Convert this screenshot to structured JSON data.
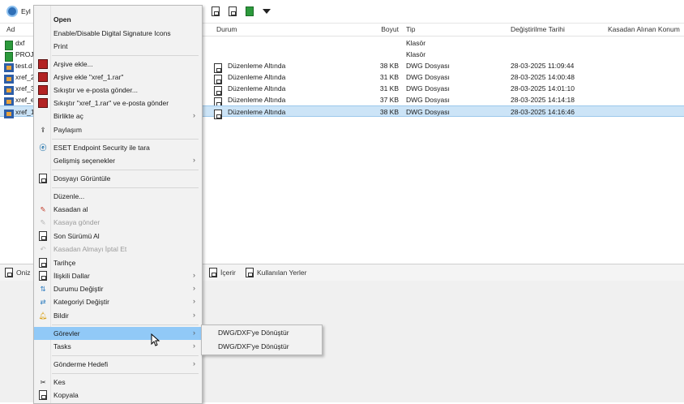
{
  "toolbar": {
    "title": "Eyl"
  },
  "columns": {
    "name": "Ad",
    "status": "Durum",
    "size": "Boyut",
    "type": "Tip",
    "modified": "Değiştirilme Tarihi",
    "checkout": "Kasadan Alınan Konum"
  },
  "rows": [
    {
      "name": "dxf",
      "status": "",
      "size": "",
      "type": "Klasör",
      "modified": "",
      "icon": "folder-icon"
    },
    {
      "name": "PROJE",
      "status": "",
      "size": "",
      "type": "Klasör",
      "modified": "",
      "icon": "folder-icon"
    },
    {
      "name": "test.d",
      "status": "Düzenleme Altında",
      "size": "38 KB",
      "type": "DWG Dosyası",
      "modified": "28-03-2025 11:09:44",
      "icon": "dwg-icon"
    },
    {
      "name": "xref_2",
      "status": "Düzenleme Altında",
      "size": "31 KB",
      "type": "DWG Dosyası",
      "modified": "28-03-2025 14:00:48",
      "icon": "dwg-icon"
    },
    {
      "name": "xref_3",
      "status": "Düzenleme Altında",
      "size": "31 KB",
      "type": "DWG Dosyası",
      "modified": "28-03-2025 14:01:10",
      "icon": "dwg-icon"
    },
    {
      "name": "xref_e",
      "status": "Düzenleme Altında",
      "size": "37 KB",
      "type": "DWG Dosyası",
      "modified": "28-03-2025 14:14:18",
      "icon": "dwg-icon"
    },
    {
      "name": "xref_1",
      "status": "Düzenleme Altında",
      "size": "38 KB",
      "type": "DWG Dosyası",
      "modified": "28-03-2025 14:16:46",
      "icon": "dwg-icon",
      "selected": true
    }
  ],
  "bottom_tabs": [
    "Oniz",
    "İçerir",
    "Kullanılan Yerler"
  ],
  "context_menu": {
    "open": "Open",
    "enable_disable": "Enable/Disable Digital Signature Icons",
    "print": "Print",
    "add_archive": "Arşive ekle...",
    "add_archive_named": "Arşive ekle \"xref_1.rar\"",
    "compress_email": "Sıkıştır ve e-posta gönder...",
    "compress_named_email": "Sıkıştır \"xref_1.rar\" ve e-posta gönder",
    "open_with": "Birlikte aç",
    "share": "Paylaşım",
    "eset_scan": "ESET Endpoint Security ile tara",
    "advanced": "Gelişmiş seçenekler",
    "view_file": "Dosyayı Görüntüle",
    "edit": "Düzenle...",
    "checkout": "Kasadan al",
    "checkin": "Kasaya gönder",
    "latest_version": "Son Sürümü Al",
    "undo_checkout": "Kasadan Almayı İptal Et",
    "history": "Tarihçe",
    "related_branches": "İlişkili Dallar",
    "change_state": "Durumu Değiştir",
    "change_category": "Kategoriyi Değiştir",
    "notify": "Bildir",
    "tasks_tr": "Görevler",
    "tasks": "Tasks",
    "send_to": "Gönderme Hedefi",
    "cut": "Kes",
    "copy": "Kopyala"
  },
  "submenu": {
    "item1": "DWG/DXF'ye Dönüştür",
    "item2": "DWG/DXF'ye Dönüştür"
  },
  "colors": {
    "highlight": "#91c9f7",
    "selected_row": "#cce4f7"
  }
}
